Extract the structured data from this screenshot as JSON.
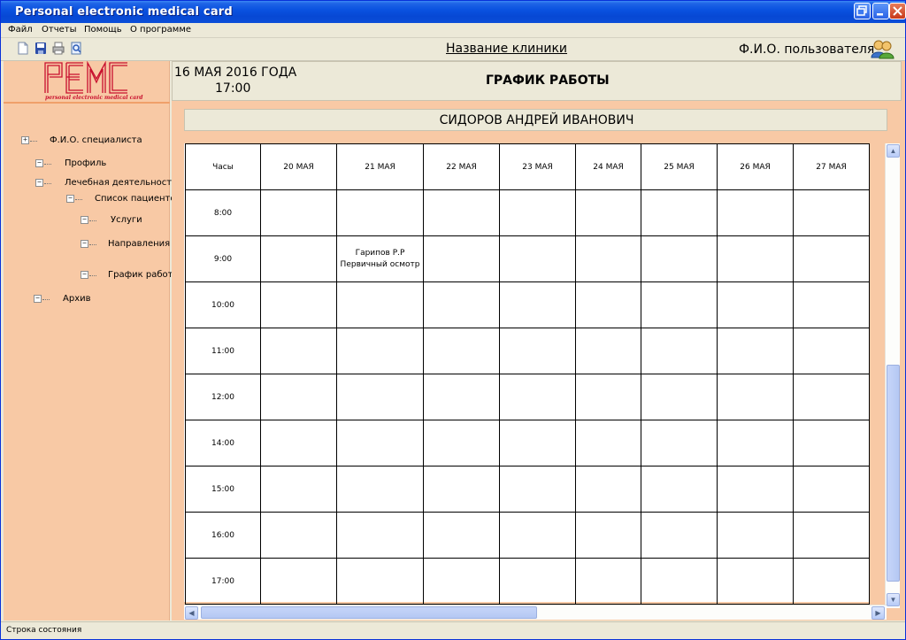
{
  "window": {
    "title": "Personal electronic medical card"
  },
  "menu": [
    "Файл",
    "Отчеты",
    "Помощь",
    "О программе"
  ],
  "toolbar": {
    "icons": [
      "new-document-icon",
      "save-icon",
      "print-icon",
      "print-preview-icon"
    ],
    "clinic_name": "Название клиники",
    "user_name": "Ф.И.О. пользователя"
  },
  "logo": {
    "text": "PEMC",
    "subtitle": "personal electronic medical card"
  },
  "sidebar": {
    "tree": [
      {
        "label": "Ф.И.О. специалиста",
        "toggle": "+"
      },
      {
        "label": "Профиль",
        "toggle": "−"
      },
      {
        "label": "Лечебная деятельность",
        "toggle": "−"
      },
      {
        "label": "Список пациентов",
        "toggle": "−"
      },
      {
        "label": "Услуги",
        "toggle": "−"
      },
      {
        "label": "Направления",
        "toggle": "−"
      },
      {
        "label": "График работы",
        "toggle": "−"
      },
      {
        "label": "Архив",
        "toggle": "−"
      }
    ]
  },
  "header": {
    "date": "16 МАЯ 2016 ГОДА",
    "time": "17:00",
    "title": "ГРАФИК РАБОТЫ"
  },
  "doctor": "СИДОРОВ АНДРЕЙ ИВАНОВИЧ",
  "schedule": {
    "hours_label": "Часы",
    "days": [
      "20 МАЯ",
      "21 МАЯ",
      "22 МАЯ",
      "23 МАЯ",
      "24 МАЯ",
      "25 МАЯ",
      "26 МАЯ",
      "27 МАЯ"
    ],
    "hours": [
      "8:00",
      "9:00",
      "10:00",
      "11:00",
      "12:00",
      "14:00",
      "15:00",
      "16:00",
      "17:00"
    ],
    "appointments": [
      {
        "hour": "9:00",
        "day": "21 МАЯ",
        "patient": "Гарипов Р.Р",
        "service": "Первичный осмотр"
      }
    ]
  },
  "statusbar": {
    "text": "Строка состояния"
  },
  "colors": {
    "sidebar_bg": "#f8c9a5",
    "titlebar": "#0a52e0",
    "logo_red": "#c8102e"
  }
}
